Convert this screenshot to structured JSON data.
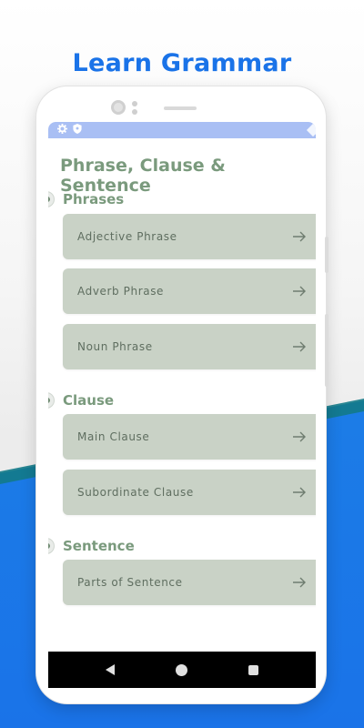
{
  "promo": {
    "headline": "Learn Grammar"
  },
  "statusbar": {
    "icons": [
      "gear-icon",
      "shield-icon"
    ]
  },
  "page": {
    "title": "Phrase, Clause & Sentence"
  },
  "sections": [
    {
      "label": "Phrases",
      "items": [
        {
          "label": "Adjective Phrase"
        },
        {
          "label": "Adverb Phrase"
        },
        {
          "label": "Noun Phrase"
        }
      ]
    },
    {
      "label": "Clause",
      "items": [
        {
          "label": "Main Clause"
        },
        {
          "label": "Subordinate Clause"
        }
      ]
    },
    {
      "label": "Sentence",
      "items": [
        {
          "label": "Parts of Sentence"
        }
      ]
    }
  ],
  "colors": {
    "headline": "#1a73e8",
    "accent_green": "#7a9a7d",
    "card_bg": "#c9d2c6",
    "statusbar": "#a9bff4"
  }
}
